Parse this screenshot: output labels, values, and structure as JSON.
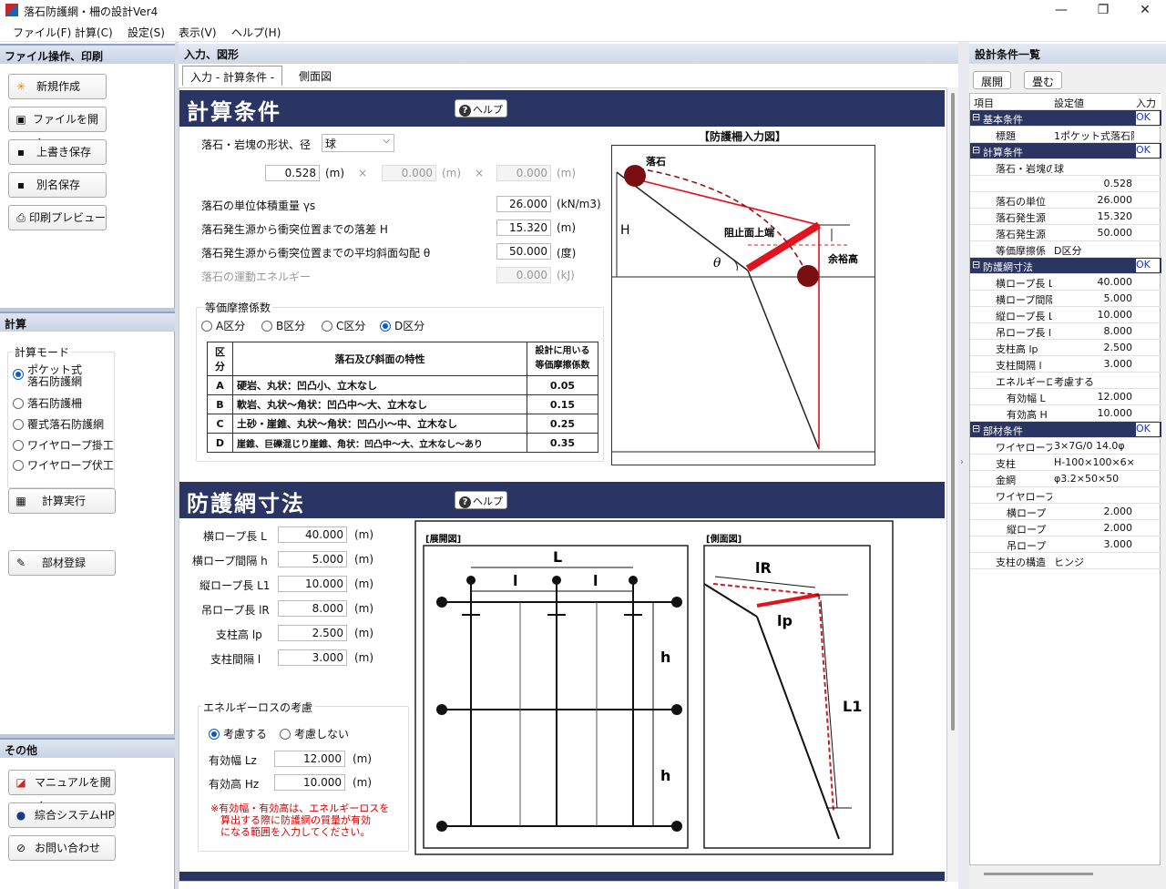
{
  "app": {
    "title": "落石防護網・柵の設計Ver4",
    "window_buttons": [
      "—",
      "❐",
      "✕"
    ]
  },
  "menu": [
    "ファイル(F)",
    "計算(C)",
    "設定(S)",
    "表示(V)",
    "ヘルプ(H)"
  ],
  "left": {
    "file_header": "ファイル操作、印刷",
    "file_buttons": [
      {
        "label": "新規作成",
        "icon": "new-icon"
      },
      {
        "label": "ファイルを開く",
        "icon": "open-icon"
      },
      {
        "label": "上書き保存",
        "icon": "save-icon"
      },
      {
        "label": "別名保存",
        "icon": "save-as-icon"
      },
      {
        "label": "印刷プレビュー",
        "icon": "print-icon"
      }
    ],
    "calc_header": "計算",
    "calc_mode_label": "計算モード",
    "calc_modes": [
      "ポケット式\n落石防護網",
      "落石防護柵",
      "覆式落石防護網",
      "ワイヤロープ掛工",
      "ワイヤロープ伏工"
    ],
    "calc_mode_selected": 0,
    "run_button": "計算実行",
    "member_button": "部材登録",
    "other_header": "その他",
    "other_buttons": [
      {
        "label": "マニュアルを開く",
        "icon": "manual-icon"
      },
      {
        "label": "綜合システムHP",
        "icon": "web-icon"
      },
      {
        "label": "お問い合わせ",
        "icon": "contact-icon"
      }
    ]
  },
  "center": {
    "header": "入力、図形",
    "tabs": [
      "入力 - 計算条件 -",
      "側面図"
    ],
    "active_tab": 0,
    "section1": {
      "title": "計算条件",
      "help": "ヘルプ",
      "shape_label": "落石・岩塊の形状、径",
      "shape_value": "球",
      "dia1": "0.528",
      "dia2": "0.000",
      "dia3": "0.000",
      "unit_m": "(m)",
      "times": "×",
      "fields": [
        {
          "label": "落石の単位体積重量 γs",
          "value": "26.000",
          "unit": "(kN/m3)",
          "disabled": false
        },
        {
          "label": "落石発生源から衝突位置までの落差 H",
          "value": "15.320",
          "unit": "(m)",
          "disabled": false
        },
        {
          "label": "落石発生源から衝突位置までの平均斜面勾配 θ",
          "value": "50.000",
          "unit": "(度)",
          "disabled": false
        },
        {
          "label": "落石の運動エネルギー",
          "value": "0.000",
          "unit": "(kJ)",
          "disabled": true
        }
      ],
      "friction_label": "等価摩擦係数",
      "friction_options": [
        "A区分",
        "B区分",
        "C区分",
        "D区分"
      ],
      "friction_selected": 3,
      "table_headers": [
        "区分",
        "落石及び斜面の特性",
        "設計に用いる\n等価摩擦係数"
      ],
      "table_rows": [
        [
          "A",
          "硬岩、丸状：凹凸小、立木なし",
          "0.05"
        ],
        [
          "B",
          "軟岩、丸状～角状：凹凸中～大、立木なし",
          "0.15"
        ],
        [
          "C",
          "土砂・崖錐、丸状～角状：凹凸小～中、立木なし",
          "0.25"
        ],
        [
          "D",
          "崖錐、巨礫混じり崖錐、角状：凹凸中～大、立木なし～あり",
          "0.35"
        ]
      ],
      "figure_title": "【防護柵入力図】",
      "figure_labels": {
        "rock": "落石",
        "H": "H",
        "top": "阻止面上端",
        "margin": "余裕高",
        "theta": "θ"
      }
    },
    "section2": {
      "title": "防護網寸法",
      "help": "ヘルプ",
      "fields": [
        {
          "label": "横ロープ長 L",
          "value": "40.000",
          "unit": "(m)"
        },
        {
          "label": "横ロープ間隔 h",
          "value": "5.000",
          "unit": "(m)"
        },
        {
          "label": "縦ロープ長 L1",
          "value": "10.000",
          "unit": "(m)"
        },
        {
          "label": "吊ロープ長 lR",
          "value": "8.000",
          "unit": "(m)"
        },
        {
          "label": "支柱高 lp",
          "value": "2.500",
          "unit": "(m)"
        },
        {
          "label": "支柱間隔 l",
          "value": "3.000",
          "unit": "(m)"
        }
      ],
      "energy_label": "エネルギーロスの考慮",
      "energy_options": [
        "考慮する",
        "考慮しない"
      ],
      "energy_selected": 0,
      "eff_fields": [
        {
          "label": "有効幅 Lz",
          "value": "12.000",
          "unit": "(m)"
        },
        {
          "label": "有効高 Hz",
          "value": "10.000",
          "unit": "(m)"
        }
      ],
      "note": "※有効幅・有効高は、エネルギーロスを\n　算出する際に防護網の質量が有効\n　になる範囲を入力してください。",
      "fig_dev_title": "[展開図]",
      "fig_side_title": "[側面図]",
      "fig_labels": {
        "L": "L",
        "l": "l",
        "h": "h",
        "lR": "lR",
        "lp": "lp",
        "L1": "L1"
      }
    }
  },
  "right": {
    "header": "設計条件一覧",
    "expand": "展開",
    "collapse": "畳む",
    "col_headers": [
      "項目",
      "設定値",
      "入力"
    ],
    "rows": [
      {
        "name": "基本条件",
        "value": "",
        "status": "OK",
        "level": 0,
        "group": true
      },
      {
        "name": "標題",
        "value": "1ポケット式落石防",
        "status": "",
        "level": 1
      },
      {
        "name": "計算条件",
        "value": "",
        "status": "OK",
        "level": 0,
        "group": true
      },
      {
        "name": "落石・岩塊の",
        "value": "球",
        "status": "",
        "level": 1
      },
      {
        "name": "",
        "value": "0.528",
        "status": "",
        "level": 2,
        "num": true
      },
      {
        "name": "落石の単位",
        "value": "26.000",
        "status": "",
        "level": 1,
        "num": true
      },
      {
        "name": "落石発生源",
        "value": "15.320",
        "status": "",
        "level": 1,
        "num": true
      },
      {
        "name": "落石発生源",
        "value": "50.000",
        "status": "",
        "level": 1,
        "num": true
      },
      {
        "name": "等価摩擦係",
        "value": "D区分",
        "status": "",
        "level": 1
      },
      {
        "name": "防護網寸法",
        "value": "",
        "status": "OK",
        "level": 0,
        "group": true
      },
      {
        "name": "横ロープ長 L",
        "value": "40.000",
        "status": "",
        "level": 1,
        "num": true
      },
      {
        "name": "横ロープ間隔",
        "value": "5.000",
        "status": "",
        "level": 1,
        "num": true
      },
      {
        "name": "縦ロープ長 L",
        "value": "10.000",
        "status": "",
        "level": 1,
        "num": true
      },
      {
        "name": "吊ロープ長 l",
        "value": "8.000",
        "status": "",
        "level": 1,
        "num": true
      },
      {
        "name": "支柱高 lp",
        "value": "2.500",
        "status": "",
        "level": 1,
        "num": true
      },
      {
        "name": "支柱間隔 l",
        "value": "3.000",
        "status": "",
        "level": 1,
        "num": true
      },
      {
        "name": "エネルギーロ",
        "value": "考慮する",
        "status": "",
        "level": 1
      },
      {
        "name": "有効幅 L",
        "value": "12.000",
        "status": "",
        "level": 2,
        "num": true
      },
      {
        "name": "有効高 H",
        "value": "10.000",
        "status": "",
        "level": 2,
        "num": true
      },
      {
        "name": "部材条件",
        "value": "",
        "status": "OK",
        "level": 0,
        "group": true
      },
      {
        "name": "ワイヤロープ",
        "value": "3×7G/0 14.0φ",
        "status": "",
        "level": 1
      },
      {
        "name": "支柱",
        "value": "H-100×100×6×",
        "status": "",
        "level": 1
      },
      {
        "name": "金網",
        "value": "φ3.2×50×50",
        "status": "",
        "level": 1
      },
      {
        "name": "ワイヤロープ(",
        "value": "",
        "status": "",
        "level": 1
      },
      {
        "name": "横ロープ",
        "value": "2.000",
        "status": "",
        "level": 2,
        "num": true
      },
      {
        "name": "縦ロープ",
        "value": "2.000",
        "status": "",
        "level": 2,
        "num": true
      },
      {
        "name": "吊ロープ",
        "value": "3.000",
        "status": "",
        "level": 2,
        "num": true
      },
      {
        "name": "支柱の構造",
        "value": "ヒンジ",
        "status": "",
        "level": 1
      }
    ]
  },
  "colors": {
    "header_navy": "#2b3563",
    "accent_red": "#e0141e",
    "rock_fill": "#7a0f12",
    "link_blue": "#1a37d6"
  }
}
